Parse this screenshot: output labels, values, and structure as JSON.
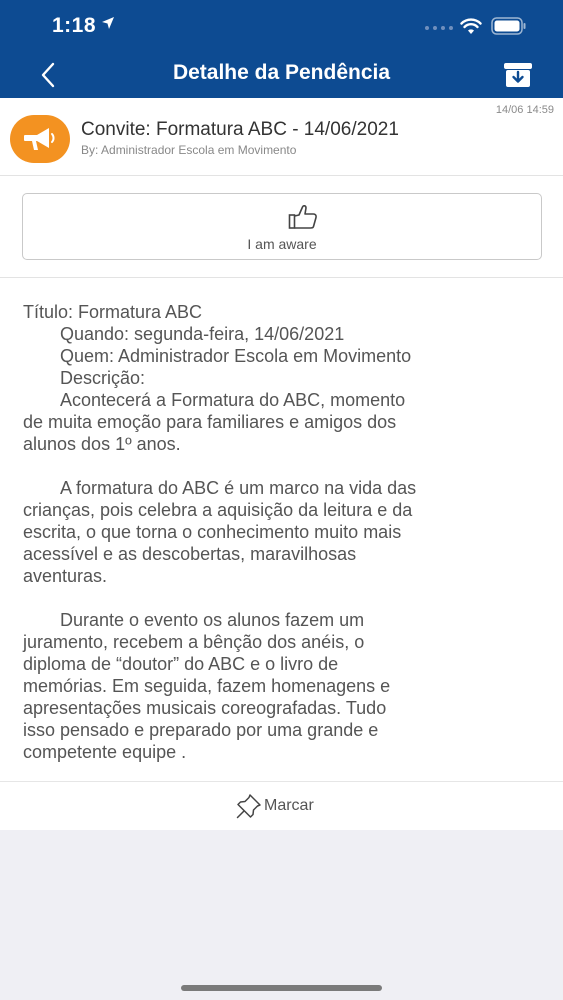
{
  "status_bar": {
    "time": "1:18"
  },
  "nav": {
    "title": "Detalhe da Pendência"
  },
  "message": {
    "timestamp": "14/06 14:59",
    "title": "Convite: Formatura ABC - 14/06/2021",
    "by": "By: Administrador Escola em Movimento",
    "icon_color": "#f39221"
  },
  "aware_button": {
    "label": "I am aware"
  },
  "body": {
    "lines": [
      "Título: Formatura ABC",
      "Quando: segunda-feira, 14/06/2021",
      "Quem: Administrador Escola em Movimento",
      "Descrição:",
      "Acontecerá a Formatura do ABC, momento",
      "de muita emoção para familiares e amigos dos",
      "alunos dos 1º anos.",
      "",
      "A formatura do ABC é um marco na vida das",
      "crianças, pois celebra a aquisição da leitura e da",
      "escrita, o que torna o conhecimento muito mais",
      "acessível e as descobertas, maravilhosas",
      "aventuras.",
      "",
      "Durante o evento os alunos fazem um",
      "juramento, recebem a bênção dos anéis, o",
      "diploma de “doutor” do ABC e o livro de",
      "memórias. Em seguida, fazem homenagens e",
      "apresentações musicais coreografadas. Tudo",
      "isso pensado e preparado por uma grande e",
      "competente equipe ."
    ]
  },
  "footer": {
    "marcar_label": "Marcar"
  },
  "colors": {
    "header": "#0d4b92",
    "accent": "#f39221"
  }
}
